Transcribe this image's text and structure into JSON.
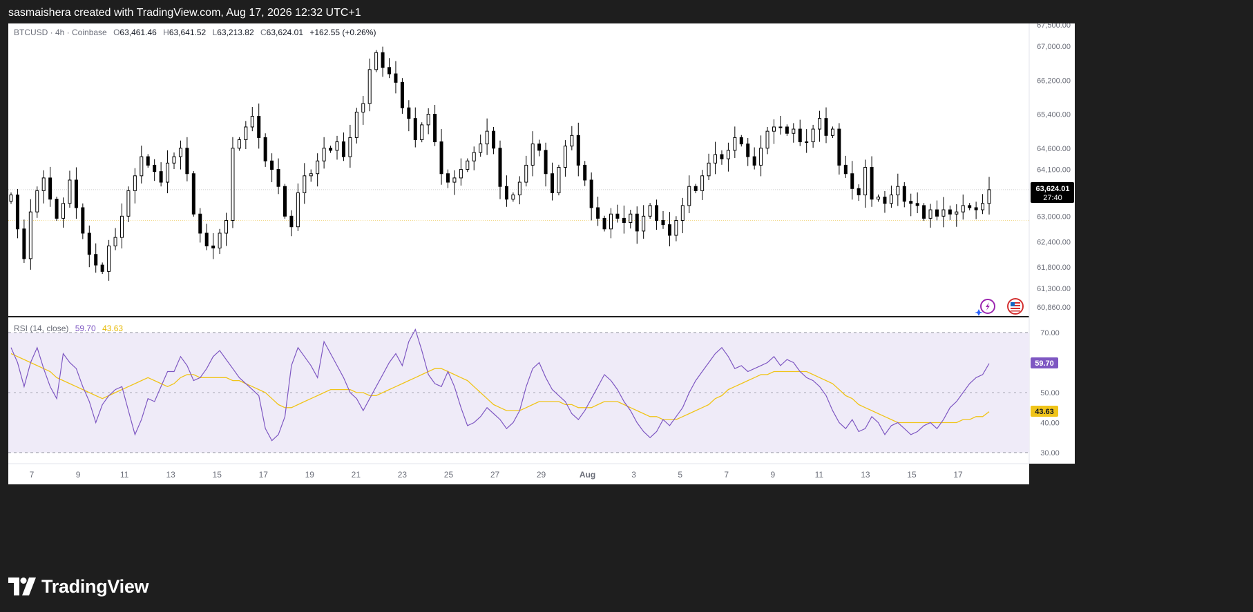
{
  "header": {
    "created_text": "sasmaishera created with TradingView.com, Aug 17, 2026 12:32 UTC+1"
  },
  "brand": {
    "name": "TradingView"
  },
  "legend": {
    "symbol": "BTCUSD · 4h · Coinbase",
    "o_label": "O",
    "o_value": "63,461.46",
    "h_label": "H",
    "h_value": "63,641.52",
    "l_label": "L",
    "l_value": "63,213.82",
    "c_label": "C",
    "c_value": "63,624.01",
    "change": "+162.55 (+0.26%)"
  },
  "rsi_legend": {
    "label": "RSI (14, close)",
    "rsi_value": "59.70",
    "ma_value": "43.63"
  },
  "colors": {
    "background": "#1e1e1e",
    "pane": "#ffffff",
    "candle": "#000000",
    "rsi_line": "#7e57c2",
    "rsi_ma": "#f0c419",
    "rsi_band": "#efebf8",
    "axis_text": "#6a6d78",
    "ref_line_yellow": "#f3d98a",
    "ref_line_gray": "#cfcfcf",
    "tag_dark": "#000000",
    "tag_rsi": "#7e57c2",
    "tag_ma": "#f0c419"
  },
  "icons": [
    "lightning-circle-icon",
    "us-flag-icon",
    "tradingview-logo-icon"
  ],
  "chart_data": [
    {
      "type": "candlestick",
      "symbol": "BTCUSD",
      "timeframe": "4h",
      "exchange": "Coinbase",
      "x_tick_labels": [
        "7",
        "9",
        "11",
        "13",
        "15",
        "17",
        "19",
        "21",
        "23",
        "25",
        "27",
        "29",
        "Aug",
        "3",
        "5",
        "7",
        "9",
        "11",
        "13",
        "15",
        "17"
      ],
      "y_tick_labels": [
        "67,500.00",
        "67,000.00",
        "66,200.00",
        "65,400.00",
        "64,600.00",
        "64,100.00",
        "63,000.00",
        "62,400.00",
        "61,800.00",
        "61,300.00",
        "60,860.00"
      ],
      "y_ticks": [
        67500,
        67000,
        66200,
        65400,
        64600,
        64100,
        63000,
        62400,
        61800,
        61300,
        60860
      ],
      "last_price_label": "63,624.01",
      "countdown": "27:40",
      "last_price": 63624.01,
      "reference_level": 62900,
      "close_approx": [
        63500,
        62700,
        62000,
        63100,
        63600,
        63900,
        63400,
        62950,
        63300,
        63850,
        63200,
        62600,
        62100,
        61850,
        61700,
        62300,
        62500,
        63000,
        63600,
        63950,
        64400,
        64200,
        64050,
        63800,
        64250,
        64400,
        64600,
        64000,
        63050,
        62600,
        62300,
        62250,
        62600,
        62900,
        64600,
        64800,
        65100,
        65350,
        64850,
        64300,
        64100,
        63700,
        63000,
        62750,
        63550,
        63950,
        64000,
        64300,
        64600,
        64550,
        64750,
        64400,
        64850,
        65450,
        65650,
        66450,
        66850,
        66500,
        66350,
        66150,
        65550,
        65300,
        64800,
        65150,
        65400,
        64750,
        64000,
        63800,
        63900,
        64100,
        64300,
        64500,
        64700,
        65000,
        64600,
        63700,
        63400,
        63500,
        63800,
        64200,
        64700,
        64550,
        64000,
        63550,
        64150,
        64650,
        64900,
        64200,
        63850,
        63200,
        62950,
        62700,
        63050,
        62950,
        62850,
        63050,
        62650,
        63000,
        63250,
        62900,
        62800,
        62550,
        62900,
        63250,
        63700,
        63600,
        63950,
        64250,
        64450,
        64350,
        64550,
        64850,
        64700,
        64400,
        64200,
        64600,
        65000,
        65100,
        65100,
        64950,
        65050,
        64750,
        64750,
        65050,
        65300,
        64900,
        65050,
        64200,
        64000,
        63650,
        63500,
        64150,
        63400,
        63450,
        63300,
        63500,
        63700,
        63350,
        63300,
        63250,
        62950,
        63150,
        63000,
        63150,
        63050,
        63100,
        63250,
        63200,
        63150,
        63300,
        63624
      ]
    },
    {
      "type": "line",
      "title": "RSI (14, close)",
      "y_tick_labels": [
        "70.00",
        "50.00",
        "40.00",
        "30.00"
      ],
      "y_ticks": [
        70,
        50,
        40,
        30
      ],
      "bands": [
        30,
        70
      ],
      "midline": 50,
      "last_rsi": 59.7,
      "last_ma": 43.63,
      "series": [
        {
          "name": "RSI",
          "values": [
            65,
            60,
            52,
            60,
            65,
            58,
            52,
            48,
            63,
            60,
            58,
            52,
            47,
            40,
            46,
            49,
            51,
            52,
            44,
            36,
            41,
            48,
            47,
            52,
            57,
            57,
            62,
            59,
            54,
            55,
            58,
            62,
            64,
            61,
            58,
            55,
            53,
            51,
            49,
            38,
            34,
            36,
            42,
            59,
            65,
            62,
            59,
            55,
            67,
            63,
            59,
            55,
            50,
            48,
            44,
            48,
            52,
            56,
            60,
            63,
            59,
            67,
            71,
            64,
            56,
            53,
            52,
            57,
            52,
            45,
            39,
            40,
            42,
            45,
            43,
            41,
            38,
            40,
            44,
            52,
            58,
            60,
            55,
            51,
            49,
            47,
            43,
            41,
            44,
            48,
            52,
            56,
            54,
            51,
            47,
            44,
            40,
            37,
            35,
            37,
            41,
            39,
            42,
            45,
            50,
            54,
            57,
            60,
            63,
            65,
            62,
            58,
            59,
            57,
            58,
            59,
            60,
            62,
            59,
            61,
            60,
            57,
            55,
            54,
            52,
            49,
            44,
            40,
            38,
            41,
            37,
            38,
            42,
            40,
            36,
            39,
            40,
            38,
            36,
            37,
            39,
            40,
            38,
            41,
            45,
            47,
            50,
            53,
            55,
            56,
            59.7
          ]
        },
        {
          "name": "MA",
          "values": [
            63,
            62,
            61,
            60,
            59,
            58,
            57,
            55,
            54,
            53,
            52,
            51,
            50,
            49,
            48,
            49,
            50,
            51,
            52,
            53,
            54,
            55,
            54,
            53,
            52,
            53,
            55,
            56,
            56,
            55,
            55,
            55,
            55,
            55,
            54,
            54,
            53,
            52,
            51,
            50,
            48,
            46,
            45,
            45,
            46,
            47,
            48,
            49,
            50,
            51,
            51,
            51,
            51,
            50,
            50,
            49,
            49,
            50,
            51,
            52,
            53,
            54,
            55,
            56,
            57,
            58,
            58,
            57,
            56,
            55,
            54,
            52,
            50,
            48,
            46,
            45,
            44,
            44,
            44,
            45,
            46,
            47,
            47,
            47,
            47,
            46,
            46,
            45,
            45,
            45,
            46,
            47,
            47,
            47,
            46,
            45,
            44,
            43,
            42,
            42,
            41,
            41,
            41,
            42,
            43,
            44,
            45,
            46,
            48,
            49,
            51,
            52,
            53,
            54,
            55,
            56,
            56,
            57,
            57,
            57,
            57,
            57,
            57,
            56,
            55,
            54,
            53,
            51,
            49,
            48,
            46,
            45,
            44,
            43,
            42,
            41,
            40,
            40,
            40,
            40,
            40,
            40,
            40,
            40,
            40,
            40,
            41,
            41,
            42,
            42,
            43.63
          ]
        }
      ]
    }
  ]
}
